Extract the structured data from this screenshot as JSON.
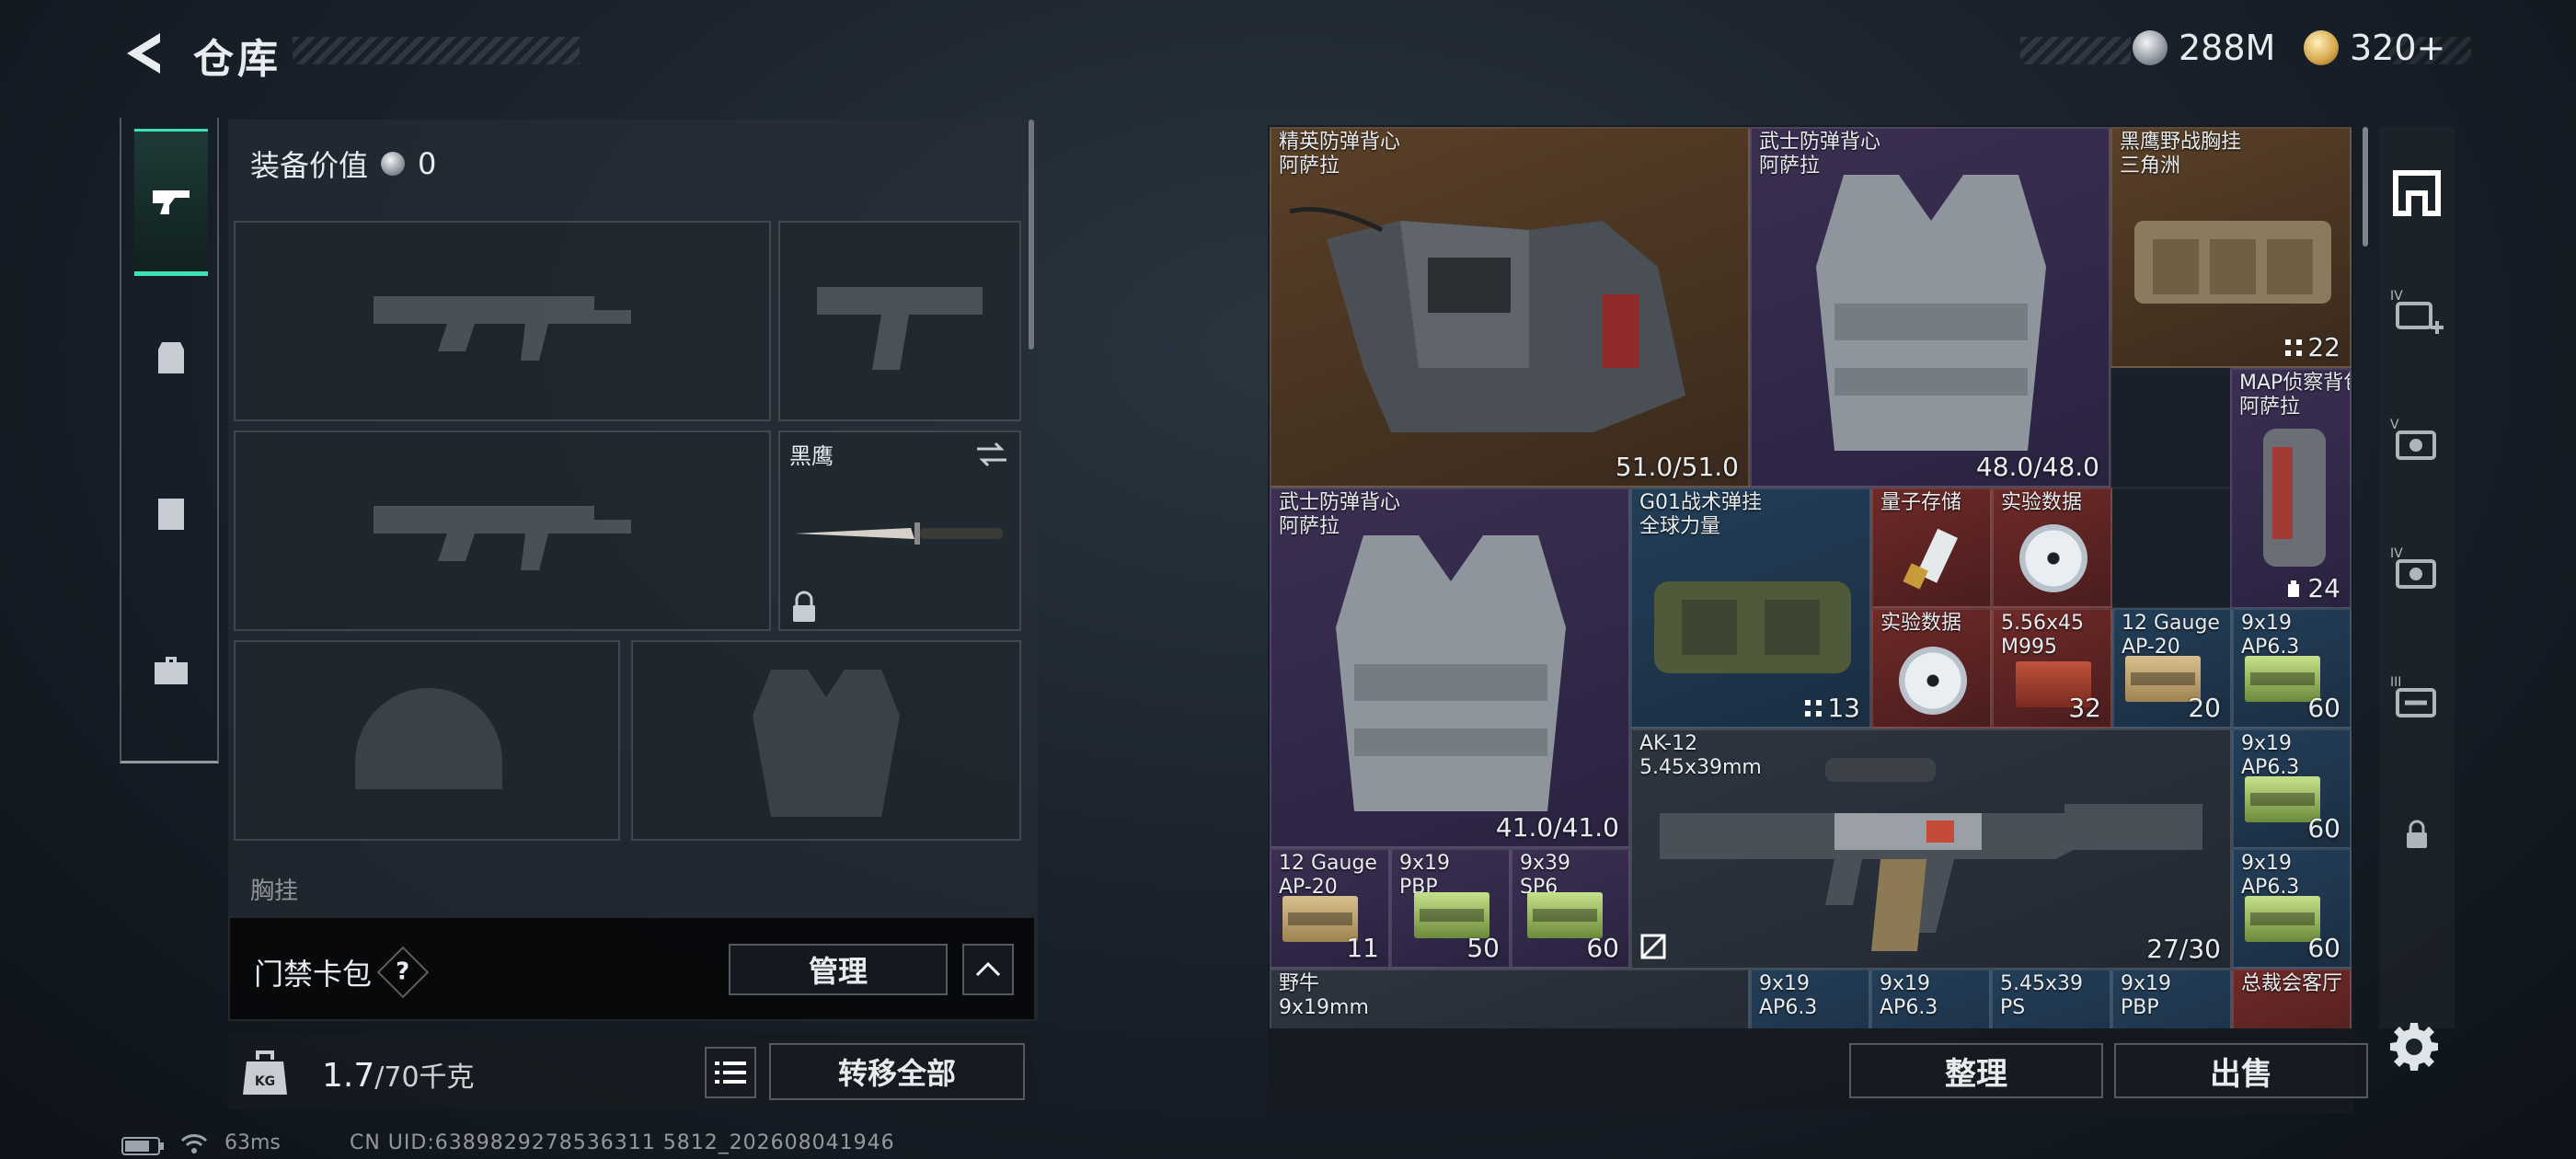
{
  "header": {
    "title": "仓库",
    "currency_silver": "288M",
    "currency_gold": "320+"
  },
  "left_nav": {
    "tabs": [
      "gun-icon",
      "backpack-icon",
      "clipboard-icon",
      "toolbox-icon"
    ]
  },
  "equipment": {
    "value_label": "装备价值",
    "value": "0",
    "knife_slot_label": "黑鹰",
    "chest_row_label": "胸挂",
    "access_card_label": "门禁卡包",
    "help_symbol": "?",
    "manage_button": "管理",
    "weight_current": "1.7",
    "weight_capacity": "/70千克",
    "transfer_all_button": "转移全部"
  },
  "stash": {
    "items": [
      {
        "name1": "精英防弹背心",
        "name2": "阿萨拉",
        "value": "51.0/51.0",
        "rarity": "brown"
      },
      {
        "name1": "武士防弹背心",
        "name2": "阿萨拉",
        "value": "48.0/48.0",
        "rarity": "purple"
      },
      {
        "name1": "黑鹰野战胸挂",
        "name2": "三角洲",
        "value": "22",
        "rarity": "brown"
      },
      {
        "name1": "MAP侦察背包",
        "name2": "阿萨拉",
        "value": "24",
        "rarity": "purple"
      },
      {
        "name1": "武士防弹背心",
        "name2": "阿萨拉",
        "value": "41.0/41.0",
        "rarity": "purple"
      },
      {
        "name1": "G01战术弹挂",
        "name2": "全球力量",
        "value": "13",
        "rarity": "blue"
      },
      {
        "name1": "量子存储",
        "name2": "",
        "value": "",
        "rarity": "red"
      },
      {
        "name1": "实验数据",
        "name2": "",
        "value": "",
        "rarity": "red"
      },
      {
        "name1": "实验数据",
        "name2": "",
        "value": "",
        "rarity": "red"
      },
      {
        "name1": "5.56x45",
        "name2": "M995",
        "value": "32",
        "rarity": "red"
      },
      {
        "name1": "12 Gauge",
        "name2": "AP-20",
        "value": "20",
        "rarity": "blue"
      },
      {
        "name1": "9x19",
        "name2": "AP6.3",
        "value": "60",
        "rarity": "blue"
      },
      {
        "name1": "AK-12",
        "name2": "5.45x39mm",
        "value": "27/30",
        "rarity": "grey"
      },
      {
        "name1": "9x19",
        "name2": "AP6.3",
        "value": "60",
        "rarity": "blue"
      },
      {
        "name1": "12 Gauge",
        "name2": "AP-20",
        "value": "11",
        "rarity": "purple"
      },
      {
        "name1": "9x19",
        "name2": "PBP",
        "value": "50",
        "rarity": "purple"
      },
      {
        "name1": "9x39",
        "name2": "SP6",
        "value": "60",
        "rarity": "purple"
      },
      {
        "name1": "9x19",
        "name2": "AP6.3",
        "value": "60",
        "rarity": "blue"
      },
      {
        "name1": "野牛",
        "name2": "9x19mm",
        "value": "",
        "rarity": "grey"
      },
      {
        "name1": "9x19",
        "name2": "AP6.3",
        "value": "",
        "rarity": "blue"
      },
      {
        "name1": "9x19",
        "name2": "AP6.3",
        "value": "",
        "rarity": "blue"
      },
      {
        "name1": "5.45x39",
        "name2": "PS",
        "value": "",
        "rarity": "blue"
      },
      {
        "name1": "9x19",
        "name2": "PBP",
        "value": "",
        "rarity": "blue"
      },
      {
        "name1": "总裁会客厅",
        "name2": "",
        "value": "",
        "rarity": "red"
      }
    ],
    "sort_button": "整理",
    "sell_button": "出售"
  },
  "right_rail": {
    "items": [
      "stash-icon",
      "card-iv-add-icon",
      "card-v-icon",
      "card-iv-icon",
      "card-iii-icon",
      "lock-icon"
    ]
  },
  "status": {
    "ping": "63ms",
    "uid": "CN UID:6389829278536311 5812_202608041946"
  },
  "colors": {
    "accent": "#3fe0b5",
    "rarity_brown": "#5a4028",
    "rarity_purple": "#3c2f52",
    "rarity_blue": "#233e58",
    "rarity_red": "#6e2a28"
  }
}
